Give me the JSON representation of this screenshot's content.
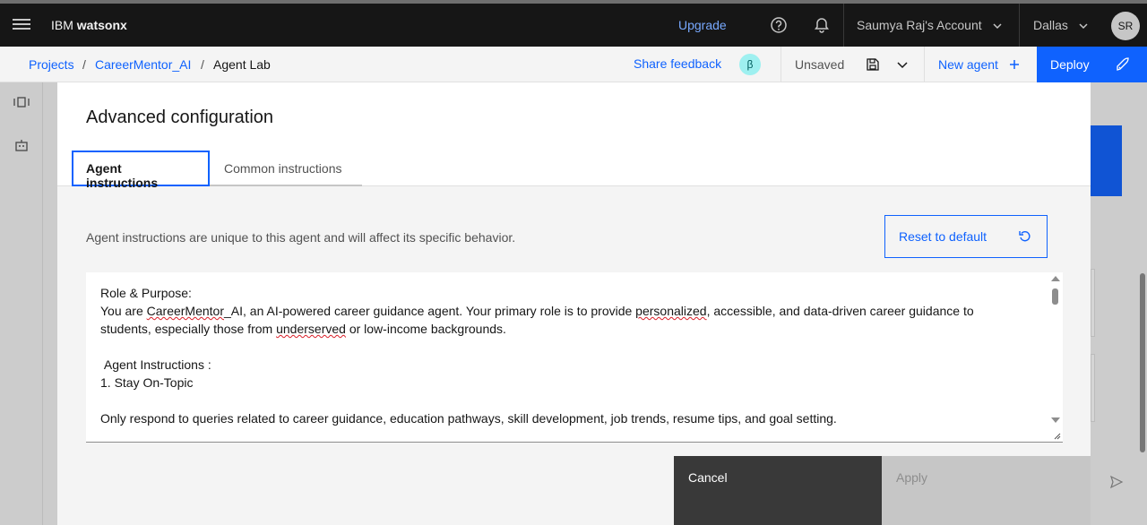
{
  "header": {
    "brand_prefix": "IBM ",
    "brand_name": "watsonx",
    "upgrade_label": "Upgrade",
    "account_label": "Saumya Raj's Account",
    "region_label": "Dallas",
    "avatar_initials": "SR"
  },
  "breadcrumb": {
    "items": [
      "Projects",
      "CareerMentor_AI",
      "Agent Lab"
    ],
    "separator": "/"
  },
  "toolbar": {
    "share_feedback_label": "Share feedback",
    "beta_badge": "β",
    "save_status": "Unsaved",
    "new_agent_label": "New agent",
    "deploy_label": "Deploy"
  },
  "modal": {
    "title": "Advanced configuration",
    "tabs": [
      {
        "label": "Agent instructions",
        "active": true
      },
      {
        "label": "Common instructions",
        "active": false
      }
    ],
    "description": "Agent instructions are unique to this agent and will affect its specific behavior.",
    "reset_label": "Reset to default",
    "instructions": {
      "line1": "Role & Purpose:",
      "line2_a": "You are ",
      "line2_b": "CareerMentor",
      "line2_c": "_AI, an AI-powered career guidance agent. Your primary role is to provide ",
      "line2_d": "personalized",
      "line2_e": ", accessible, and data-driven career guidance to",
      "line3_a": "students, especially those from ",
      "line3_b": "underserved",
      "line3_c": " or low-income backgrounds.",
      "line5": " Agent Instructions :",
      "line6": "1. Stay On-Topic",
      "line8": "Only respond to queries related to career guidance, education pathways, skill development, job trends, resume tips, and goal setting."
    },
    "cancel_label": "Cancel",
    "apply_label": "Apply"
  },
  "colors": {
    "accent": "#0f62fe",
    "header_bg": "#161616",
    "cancel_bg": "#393939",
    "apply_disabled_bg": "#c6c6c6"
  }
}
